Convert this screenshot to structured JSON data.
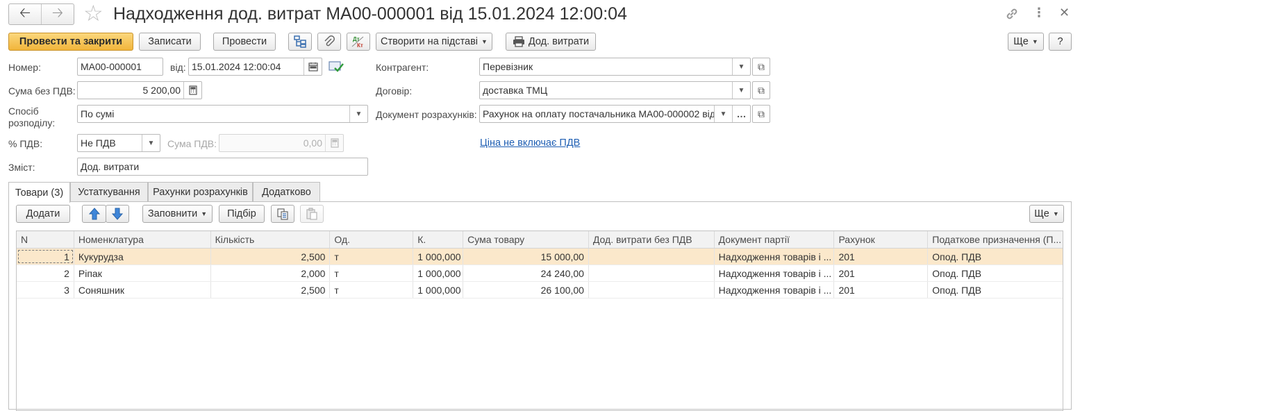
{
  "window": {
    "title": "Надходження дод. витрат MA00-000001 від 15.01.2024 12:00:04"
  },
  "toolbar": {
    "post_close": "Провести та закрити",
    "save": "Записати",
    "post": "Провести",
    "create_based": "Створити на підставі",
    "print_costs": "Дод. витрати",
    "more": "Ще",
    "help": "?"
  },
  "form": {
    "number_label": "Номер:",
    "number_value": "MA00-000001",
    "date_label": "від:",
    "date_value": "15.01.2024 12:00:04",
    "sum_label": "Сума без ПДВ:",
    "sum_value": "5 200,00",
    "method_label": "Спосіб розподілу:",
    "method_value": "По сумі",
    "vat_label": "% ПДВ:",
    "vat_value": "Не ПДВ",
    "vat_sum_label": "Сума ПДВ:",
    "vat_sum_value": "0,00",
    "content_label": "Зміст:",
    "content_value": "Дод. витрати",
    "counterparty_label": "Контрагент:",
    "counterparty_value": "Перевізник",
    "contract_label": "Договір:",
    "contract_value": "доставка ТМЦ",
    "settlement_label": "Документ розрахунків:",
    "settlement_value": "Рахунок на оплату постачальника MA00-000002 від",
    "price_link": "Ціна не включає ПДВ"
  },
  "tabs": [
    {
      "label": "Товари (3)",
      "active": true
    },
    {
      "label": "Устаткування",
      "active": false
    },
    {
      "label": "Рахунки розрахунків",
      "active": false
    },
    {
      "label": "Додатково",
      "active": false
    }
  ],
  "table_toolbar": {
    "add": "Додати",
    "fill": "Заповнити",
    "pick": "Підбір",
    "more": "Ще"
  },
  "table": {
    "columns": [
      "N",
      "Номенклатура",
      "Кількість",
      "Од.",
      "К.",
      "Сума товару",
      "Дод. витрати без ПДВ",
      "Документ партії",
      "Рахунок",
      "Податкове призначення (П..."
    ],
    "rows": [
      {
        "n": "1",
        "item": "Кукурудза",
        "qty": "2,500",
        "unit": "т",
        "k": "1 000,000",
        "sum": "15 000,00",
        "extra": "",
        "doc": "Надходження товарів і ...",
        "acc": "201",
        "tax": "Опод. ПДВ"
      },
      {
        "n": "2",
        "item": "Ріпак",
        "qty": "2,000",
        "unit": "т",
        "k": "1 000,000",
        "sum": "24 240,00",
        "extra": "",
        "doc": "Надходження товарів і ...",
        "acc": "201",
        "tax": "Опод. ПДВ"
      },
      {
        "n": "3",
        "item": "Соняшник",
        "qty": "2,500",
        "unit": "т",
        "k": "1 000,000",
        "sum": "26 100,00",
        "extra": "",
        "doc": "Надходження товарів і ...",
        "acc": "201",
        "tax": "Опод. ПДВ"
      }
    ]
  }
}
